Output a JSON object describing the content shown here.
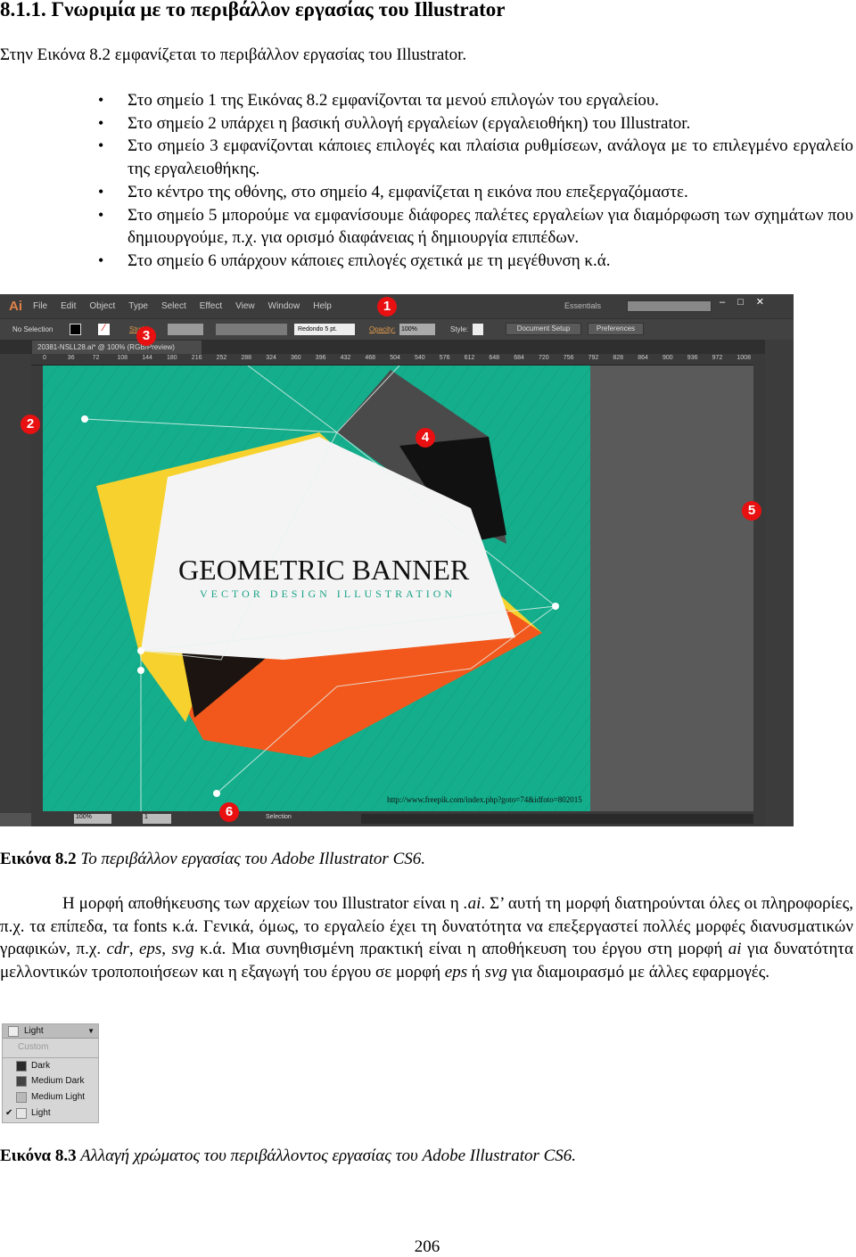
{
  "heading": "8.1.1. Γνωριμία με το περιβάλλον εργασίας του Illustrator",
  "intro": "Στην Εικόνα 8.2 εμφανίζεται το περιβάλλον εργασίας του Illustrator.",
  "bullets": [
    "Στο σημείο 1 της Εικόνας 8.2 εμφανίζονται τα μενού επιλογών του εργαλείου.",
    "Στο σημείο 2 υπάρχει η βασική συλλογή εργαλείων (εργαλειοθήκη) του Illustrator.",
    "Στο σημείο 3 εμφανίζονται κάποιες επιλογές και πλαίσια ρυθμίσεων, ανάλογα με το επιλεγμένο εργαλείο της εργαλειοθήκης.",
    "Στο κέντρο της οθόνης, στο σημείο 4, εμφανίζεται η εικόνα που επεξεργαζόμαστε.",
    "Στο σημείο 5 μπορούμε να εμφανίσουμε διάφορες παλέτες εργαλείων για διαμόρφωση των σχημάτων που δημιουργούμε, π.χ. για ορισμό διαφάνειας ή δημιουργία επιπέδων.",
    "Στο σημείο 6 υπάρχουν κάποιες επιλογές σχετικά με τη μεγέθυνση κ.ά."
  ],
  "illustrator": {
    "logo": "Ai",
    "menus": [
      "File",
      "Edit",
      "Object",
      "Type",
      "Select",
      "Effect",
      "View",
      "Window",
      "Help"
    ],
    "workspace": "Essentials",
    "control": {
      "selection": "No Selection",
      "stroke": "Stroke",
      "brush": "Redondo 5 pt.",
      "opacity_label": "Opacity:",
      "opacity": "100%",
      "style_label": "Style:",
      "doc_setup": "Document Setup",
      "preferences": "Preferences"
    },
    "tab": "20381-NSLL28.ai* @ 100% (RGB/Preview)",
    "ruler": [
      "0",
      "36",
      "72",
      "108",
      "144",
      "180",
      "216",
      "252",
      "288",
      "324",
      "360",
      "396",
      "432",
      "468",
      "504",
      "540",
      "576",
      "612",
      "648",
      "684",
      "720",
      "756",
      "792",
      "828",
      "864",
      "900",
      "936",
      "972",
      "1008"
    ],
    "art_title": "GEOMETRIC BANNER",
    "art_subtitle": "VECTOR DESIGN ILLUSTRATION",
    "credit": "http://www.freepik.com/index.php?goto=74&idfoto=802015",
    "status": {
      "zoom": "100%",
      "page": "1",
      "tool": "Selection"
    },
    "markers": [
      "1",
      "2",
      "3",
      "4",
      "5",
      "6"
    ],
    "colors": {
      "teal": "#14ae8c",
      "yellow": "#f7d22e",
      "orange": "#f2581c",
      "marker": "#e81010"
    }
  },
  "caption1": {
    "label": "Εικόνα 8.2",
    "text": " Το περιβάλλον εργασίας του Adobe Illustrator CS6."
  },
  "paragraph": [
    "Η μορφή αποθήκευσης των αρχείων του Illustrator είναι η ",
    ".ai",
    ". Σ’ αυτή τη μορφή διατηρούνται όλες οι πληροφορίες, π.χ. τα επίπεδα, τα fonts κ.ά. Γενικά, όμως, το εργαλείο έχει τη δυνατότητα να επεξεργαστεί πολλές μορφές διανυσματικών γραφικών, π.χ. ",
    "cdr",
    ", ",
    "eps",
    ", ",
    "svg",
    " κ.ά. Μια συνηθισμένη πρακτική είναι η αποθήκευση του έργου στη μορφή ",
    "ai",
    " για δυνατότητα μελλοντικών τροποποιήσεων και η εξαγωγή του έργου σε μορφή ",
    "eps",
    " ή ",
    "svg",
    " για διαμοιρασμό με άλλες εφαρμογές."
  ],
  "theme_dropdown": {
    "selected": "Light",
    "options": [
      "Custom",
      "Dark",
      "Medium Dark",
      "Medium Light",
      "Light"
    ],
    "checked": "Light"
  },
  "caption2": {
    "label": "Εικόνα 8.3",
    "text": " Αλλαγή χρώματος του περιβάλλοντος εργασίας του Adobe Illustrator CS6."
  },
  "page_number": "206"
}
